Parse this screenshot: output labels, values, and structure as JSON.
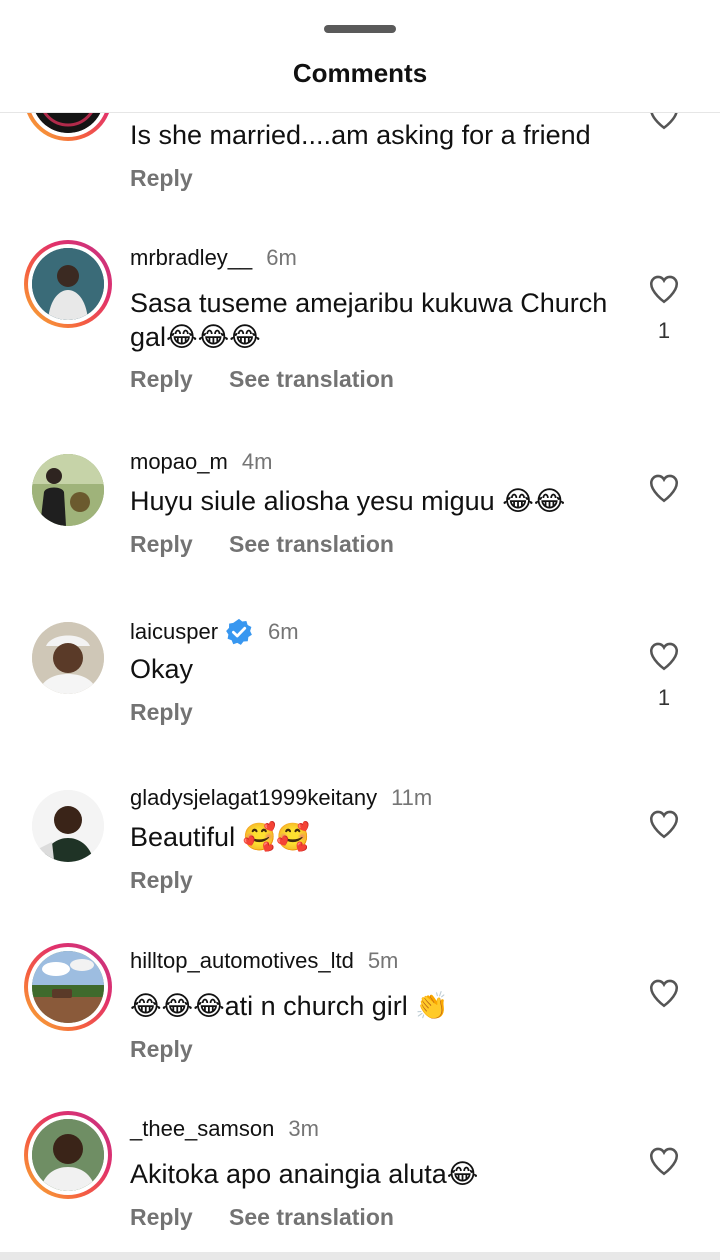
{
  "header": {
    "title": "Comments"
  },
  "actions": {
    "reply": "Reply",
    "see_translation": "See translation"
  },
  "comments": [
    {
      "username": "",
      "time": "",
      "text": "Is she married....am asking for a friend",
      "likes": "",
      "translation": false
    },
    {
      "username": "mrbradley__",
      "time": "6m",
      "text": "Sasa tuseme amejaribu kukuwa Church gal😂😂😂",
      "likes": "1",
      "translation": true
    },
    {
      "username": "mopao_m",
      "time": "4m",
      "text": "Huyu siule aliosha yesu miguu 😂😂",
      "likes": "",
      "translation": true
    },
    {
      "username": "laicusper",
      "time": "6m",
      "text": "Okay",
      "likes": "1",
      "translation": false,
      "verified": true
    },
    {
      "username": "gladysjelagat1999keitany",
      "time": "11m",
      "text": "Beautiful 🥰🥰",
      "likes": "",
      "translation": false
    },
    {
      "username": "hilltop_automotives_ltd",
      "time": "5m",
      "text": "😂😂😂ati n church girl 👏",
      "likes": "",
      "translation": false
    },
    {
      "username": "_thee_samson",
      "time": "3m",
      "text": "Akitoka apo anaingia aluta😂",
      "likes": "",
      "translation": true
    }
  ],
  "colors": {
    "accent_verified": "#3897f0",
    "ring_start": "#f7b733",
    "ring_end": "#c13584"
  }
}
